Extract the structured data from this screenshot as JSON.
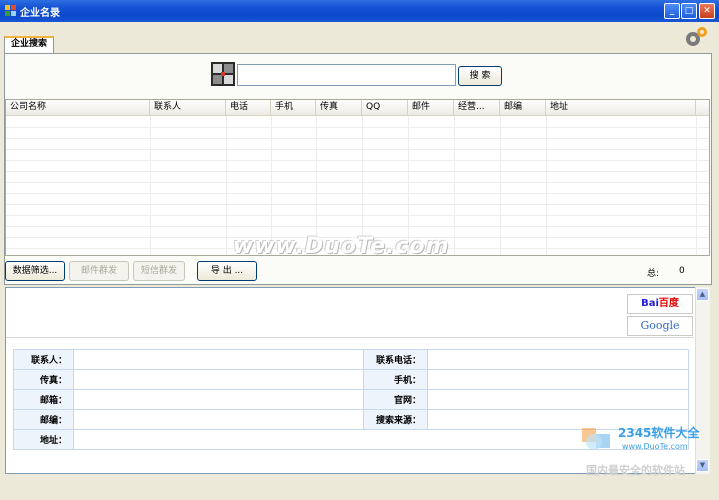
{
  "window": {
    "title": "企业名录",
    "minimize": "_",
    "maximize": "□",
    "close": "✕"
  },
  "tabs": [
    {
      "label": "企业搜索"
    }
  ],
  "search": {
    "value": "",
    "button_label": "搜 索"
  },
  "table": {
    "columns": [
      "公司名称",
      "联系人",
      "电话",
      "手机",
      "传真",
      "QQ",
      "邮件",
      "经营...",
      "邮编",
      "地址"
    ],
    "rows": []
  },
  "toolbar": {
    "filter_label": "数据筛选...",
    "mail_label": "邮件群发",
    "sms_label": "短信群发",
    "export_label": "导 出 ..."
  },
  "total": {
    "label": "总:",
    "value": "0"
  },
  "engines": {
    "baidu_a": "Bai",
    "baidu_b": "百度",
    "google": "Google"
  },
  "detail": {
    "contact_label": "联系人：",
    "phone_label": "联系电话：",
    "fax_label": "传真：",
    "mobile_label": "手机：",
    "email_label": "邮箱：",
    "website_label": "官网：",
    "zip_label": "邮编：",
    "source_label": "搜索来源：",
    "address_label": "地址："
  },
  "watermarks": {
    "duote": "www.DuoTe.com",
    "brand": "2345软件大全",
    "url": "www.DuoTe.com",
    "slogan": "国内最安全的软件站"
  },
  "colors": {
    "titlebar": "#0a47c8",
    "window_bg": "#ece9d8",
    "detail_label_bg": "#eef4fb"
  }
}
